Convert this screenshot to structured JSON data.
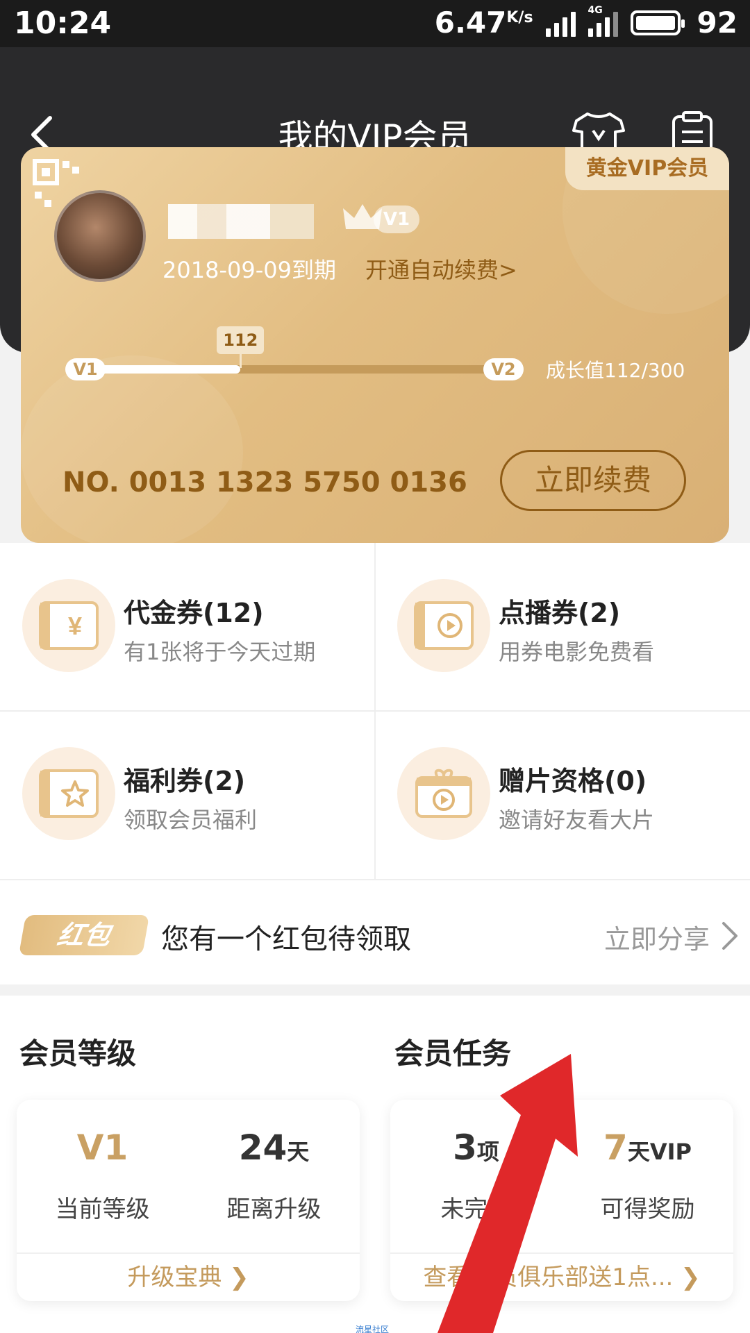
{
  "status_bar": {
    "time": "10:24",
    "net_speed": "6.47",
    "net_unit": "K/s",
    "net_type": "4G",
    "battery": "92"
  },
  "header": {
    "title": "我的VIP会员",
    "icons": [
      "back-icon",
      "shirt-icon",
      "clipboard-icon"
    ]
  },
  "card": {
    "badge": "黄金VIP会员",
    "level": "V1",
    "expiry": "2018-09-09到期",
    "auto_renew": "开通自动续费>",
    "progress_from": "V1",
    "progress_to": "V2",
    "progress_marker": "112",
    "progress_fraction": 0.373,
    "growth_text": "成长值112/300",
    "card_number": "NO. 0013 1323 5750 0136",
    "renew_button": "立即续费",
    "colors": {
      "card": "#e2bd82",
      "accent": "#8f5c16"
    }
  },
  "coupons": [
    {
      "title": "代金券(12)",
      "subtitle": "有1张将于今天过期",
      "icon": "yen-ticket-icon"
    },
    {
      "title": "点播券(2)",
      "subtitle": "用券电影免费看",
      "icon": "play-ticket-icon"
    },
    {
      "title": "福利券(2)",
      "subtitle": "领取会员福利",
      "icon": "star-ticket-icon"
    },
    {
      "title": "赠片资格(0)",
      "subtitle": "邀请好友看大片",
      "icon": "gift-play-icon"
    }
  ],
  "red_packet": {
    "tag": "红包",
    "text": "您有一个红包待领取",
    "action": "立即分享"
  },
  "member_level": {
    "title": "会员等级",
    "current_value": "V1",
    "current_label": "当前等级",
    "days_value": "24",
    "days_unit": "天",
    "days_label": "距离升级",
    "footer": "升级宝典 ❯"
  },
  "member_tasks": {
    "title": "会员任务",
    "count_value": "3",
    "count_unit": "项",
    "count_label": "未完成",
    "reward_value": "7",
    "reward_unit": "天VIP",
    "reward_label": "可得奖励",
    "footer": "查看会员俱乐部送1点... ❯"
  },
  "watermark": "流星社区"
}
